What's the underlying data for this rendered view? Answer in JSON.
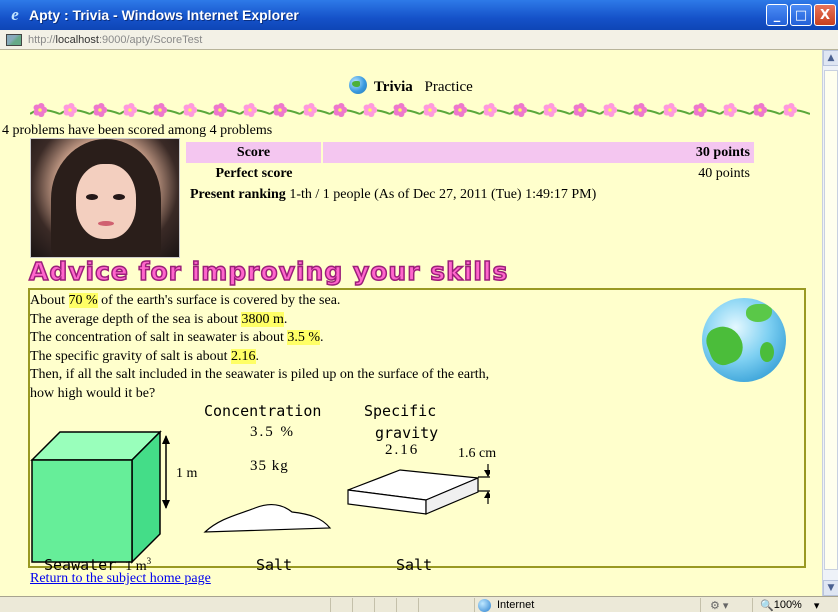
{
  "window": {
    "title": "Apty : Trivia - Windows Internet Explorer",
    "minimize": "_",
    "maximize": "□",
    "close": "X"
  },
  "address": {
    "url_prefix": "http://",
    "url_host": "localhost",
    "url_rest": ":9000/apty/ScoreTest"
  },
  "header": {
    "title": "Trivia",
    "subtitle": "Practice"
  },
  "summary": "4 problems have been scored among 4 problems",
  "scores": {
    "score_label": "Score",
    "score_value": "30 points",
    "perfect_label": "Perfect score",
    "perfect_value": "40 points",
    "ranking_label": "Present ranking",
    "ranking_value": "1-th / 1 people (As of Dec 27, 2011 (Tue) 1:49:17 PM)"
  },
  "advice_title": "Advice for improving your skills",
  "problem": {
    "l1a": "About ",
    "l1h": "70 %",
    "l1b": " of the earth's surface is covered by the sea.",
    "l2a": "The average depth of the sea is about ",
    "l2h": "3800 m",
    "l2b": ".",
    "l3a": "The concentration of salt in seawater is about ",
    "l3h": "3.5 %",
    "l3b": ".",
    "l4a": "The specific gravity of salt is about ",
    "l4h": "2.16",
    "l4b": ".",
    "l5": "Then, if all the salt included in the seawater is piled up on the surface of the earth,",
    "l6": "how high would it be?"
  },
  "diagram": {
    "cube_height": "1 m",
    "seawater_label": "Seawater",
    "seawater_unit": "1 m",
    "seawater_exp": "3",
    "concentration_label": "Concentration",
    "concentration_value": "3.5 %",
    "salt_mass": "35 kg",
    "salt_label_1": "Salt",
    "specific_label": "Specific",
    "gravity_label": "gravity",
    "gravity_value": "2.16",
    "slab_height": "1.6 cm",
    "salt_label_2": "Salt"
  },
  "return_link": "Return to the subject home page",
  "status": {
    "zone": "Internet",
    "zoom": "100%"
  },
  "colors": {
    "page_bg": "#ffffcc",
    "score_row": "#f4c6f0",
    "advice_title": "#ff66cc",
    "highlight": "#ffff66",
    "cube": "#66ee99"
  }
}
